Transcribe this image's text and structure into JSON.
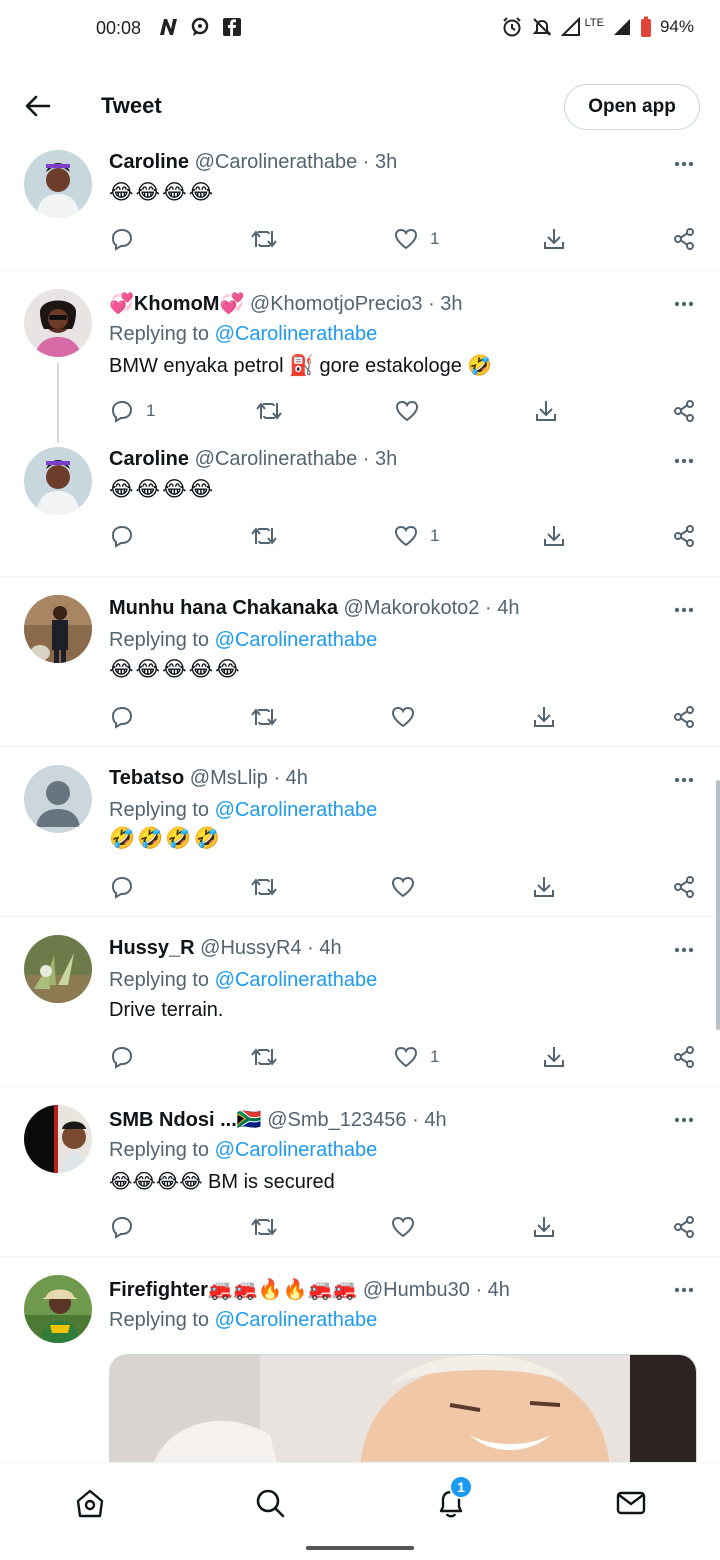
{
  "status_bar": {
    "time": "00:08",
    "battery": "94%",
    "network": "LTE"
  },
  "header": {
    "title": "Tweet",
    "open_app_label": "Open app"
  },
  "colors": {
    "accent": "#1d9bf0",
    "text_primary": "#0f1419",
    "text_secondary": "#536471"
  },
  "tweets": [
    {
      "name": "Caroline",
      "handle": "@Carolinerathabe",
      "time": "· 3h",
      "replying_prefix": "",
      "replying_to": "",
      "body": "😂😂😂😂",
      "reply_count": "",
      "like_count": "1"
    },
    {
      "name": "💞KhomoM💞",
      "handle": "@KhomotjoPrecio3",
      "time": "· 3h",
      "replying_prefix": "Replying to",
      "replying_to": "@Carolinerathabe",
      "body": "BMW enyaka petrol ⛽ gore estakologe 🤣",
      "reply_count": "1",
      "like_count": ""
    },
    {
      "name": "Caroline",
      "handle": "@Carolinerathabe",
      "time": "· 3h",
      "replying_prefix": "",
      "replying_to": "",
      "body": "😂😂😂😂",
      "reply_count": "",
      "like_count": "1"
    },
    {
      "name": "Munhu hana Chakanaka",
      "handle": "@Makorokoto2",
      "time": "· 4h",
      "replying_prefix": "Replying to",
      "replying_to": "@Carolinerathabe",
      "body": "😂😂😂😂😂",
      "reply_count": "",
      "like_count": ""
    },
    {
      "name": "Tebatso",
      "handle": "@MsLlip",
      "time": "· 4h",
      "replying_prefix": "Replying to",
      "replying_to": "@Carolinerathabe",
      "body": "🤣🤣🤣🤣",
      "reply_count": "",
      "like_count": ""
    },
    {
      "name": "Hussy_R",
      "handle": "@HussyR4",
      "time": "· 4h",
      "replying_prefix": "Replying to",
      "replying_to": "@Carolinerathabe",
      "body": "Drive terrain.",
      "reply_count": "",
      "like_count": "1"
    },
    {
      "name": "SMB Ndosi ...🇿🇦",
      "handle": "@Smb_123456",
      "time": "· 4h",
      "replying_prefix": "Replying to",
      "replying_to": "@Carolinerathabe",
      "body": "😂😂😂😂 BM is secured",
      "reply_count": "",
      "like_count": ""
    },
    {
      "name": "Firefighter🚒🚒🔥🔥🚒🚒",
      "handle": "@Humbu30",
      "time": "· 4h",
      "replying_prefix": "Replying to",
      "replying_to": "@Carolinerathabe",
      "body": "",
      "reply_count": "",
      "like_count": ""
    }
  ],
  "bottom_nav": {
    "notification_badge": "1",
    "items": [
      "home-icon",
      "search-icon",
      "bell-icon",
      "mail-icon"
    ]
  }
}
